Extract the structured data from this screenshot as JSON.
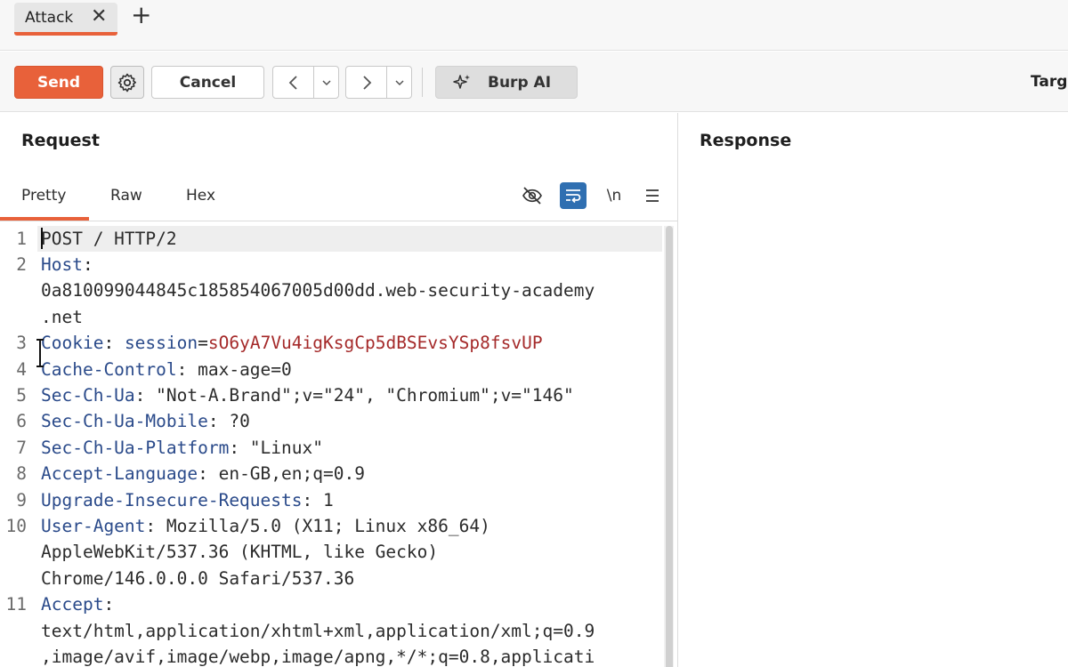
{
  "tabs": {
    "active_label": "Attack",
    "close_glyph": "✕",
    "add_glyph": "+"
  },
  "toolbar": {
    "send_label": "Send",
    "cancel_label": "Cancel",
    "ai_label": "Burp AI",
    "target_label": "Targ"
  },
  "request": {
    "title": "Request",
    "tabs": [
      "Pretty",
      "Raw",
      "Hex"
    ],
    "newline_label": "\\n",
    "lines": [
      {
        "n": "1",
        "rows": [
          [
            {
              "t": "POST / HTTP/2",
              "c": "v"
            }
          ]
        ]
      },
      {
        "n": "2",
        "rows": [
          [
            {
              "t": "Host",
              "c": "k"
            },
            {
              "t": ":",
              "c": "c"
            }
          ],
          [
            {
              "t": "0a810099044845c185854067005d00dd.web-security-academy",
              "c": "v"
            }
          ],
          [
            {
              "t": ".net",
              "c": "v"
            }
          ]
        ]
      },
      {
        "n": "3",
        "rows": [
          [
            {
              "t": "Cookie",
              "c": "k"
            },
            {
              "t": ": ",
              "c": "c"
            },
            {
              "t": "session",
              "c": "k"
            },
            {
              "t": "=",
              "c": "c"
            },
            {
              "t": "sO6yA7Vu4igKsgCp5dBSEvsYSp8fsvUP",
              "c": "sv"
            }
          ]
        ]
      },
      {
        "n": "4",
        "rows": [
          [
            {
              "t": "Cache-Control",
              "c": "k"
            },
            {
              "t": ": max-age=0",
              "c": "v"
            }
          ]
        ]
      },
      {
        "n": "5",
        "rows": [
          [
            {
              "t": "Sec-Ch-Ua",
              "c": "k"
            },
            {
              "t": ": \"Not-A.Brand\";v=\"24\", \"Chromium\";v=\"146\"",
              "c": "v"
            }
          ]
        ]
      },
      {
        "n": "6",
        "rows": [
          [
            {
              "t": "Sec-Ch-Ua-Mobile",
              "c": "k"
            },
            {
              "t": ": ?0",
              "c": "v"
            }
          ]
        ]
      },
      {
        "n": "7",
        "rows": [
          [
            {
              "t": "Sec-Ch-Ua-Platform",
              "c": "k"
            },
            {
              "t": ": \"Linux\"",
              "c": "v"
            }
          ]
        ]
      },
      {
        "n": "8",
        "rows": [
          [
            {
              "t": "Accept-Language",
              "c": "k"
            },
            {
              "t": ": en-GB,en;q=0.9",
              "c": "v"
            }
          ]
        ]
      },
      {
        "n": "9",
        "rows": [
          [
            {
              "t": "Upgrade-Insecure-Requests",
              "c": "k"
            },
            {
              "t": ": 1",
              "c": "v"
            }
          ]
        ]
      },
      {
        "n": "10",
        "rows": [
          [
            {
              "t": "User-Agent",
              "c": "k"
            },
            {
              "t": ": Mozilla/5.0 (X11; Linux x86_64)",
              "c": "v"
            }
          ],
          [
            {
              "t": "AppleWebKit/537.36 (KHTML, like Gecko)",
              "c": "v"
            }
          ],
          [
            {
              "t": "Chrome/146.0.0.0 Safari/537.36",
              "c": "v"
            }
          ]
        ]
      },
      {
        "n": "11",
        "rows": [
          [
            {
              "t": "Accept",
              "c": "k"
            },
            {
              "t": ":",
              "c": "c"
            }
          ],
          [
            {
              "t": "text/html,application/xhtml+xml,application/xml;q=0.9",
              "c": "v"
            }
          ],
          [
            {
              "t": ",image/avif,image/webp,image/apng,*/*;q=0.8,applicati",
              "c": "v"
            }
          ]
        ]
      }
    ]
  },
  "response": {
    "title": "Response"
  },
  "colors": {
    "accent": "#e8613a",
    "header_key": "#2a4a8a",
    "cookie_value": "#a52a2a",
    "wrap_active": "#2f6fb1"
  },
  "icons": [
    "settings-gear-icon",
    "chevron-left-icon",
    "chevron-down-icon",
    "chevron-right-icon",
    "sparkle-icon",
    "eye-off-icon",
    "wrap-lines-icon",
    "hamburger-menu-icon",
    "text-cursor-icon"
  ]
}
